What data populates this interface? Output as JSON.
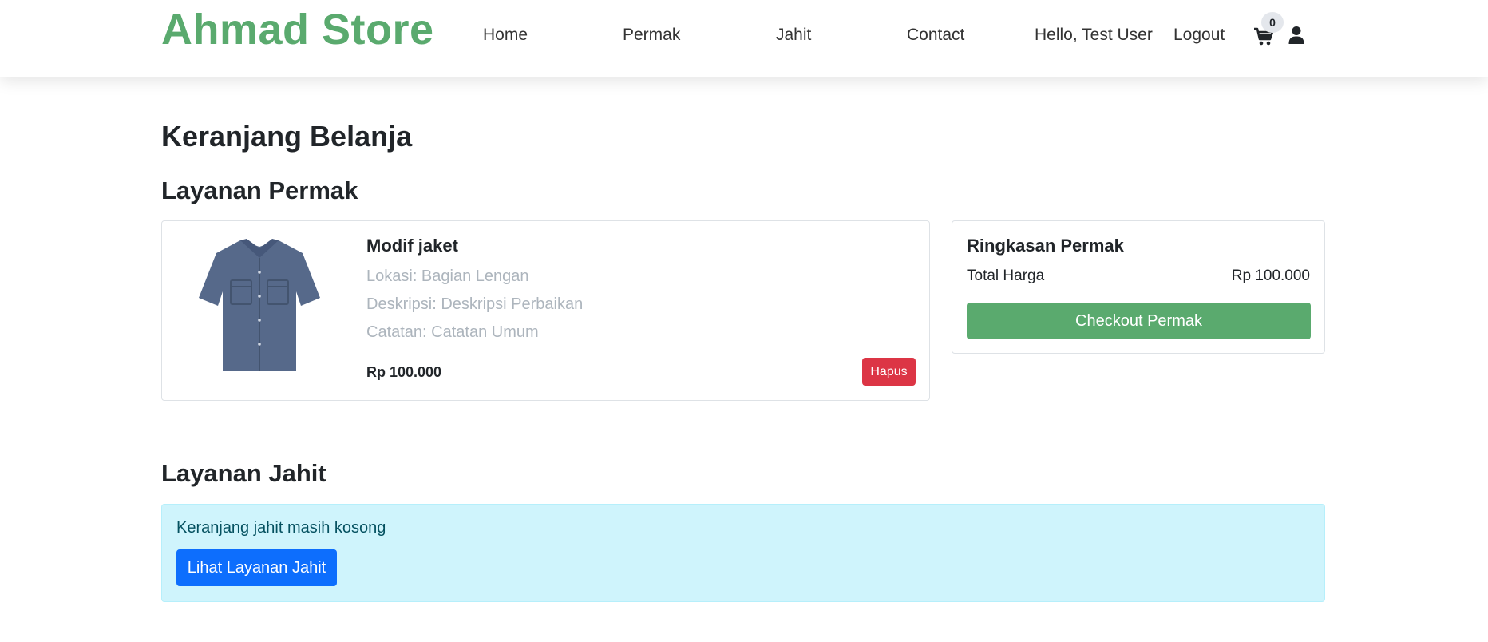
{
  "brand": {
    "name": "Ahmad Store",
    "color": "#5aaa6e"
  },
  "nav": {
    "links": [
      "Home",
      "Permak",
      "Jahit",
      "Contact"
    ],
    "greeting": "Hello, Test User",
    "logout": "Logout",
    "cart_count": "0",
    "icons": [
      "cart-icon",
      "user-icon"
    ]
  },
  "page": {
    "title": "Keranjang Belanja"
  },
  "permak": {
    "section_title": "Layanan Permak",
    "items": [
      {
        "image": "shirt-image",
        "title": "Modif jaket",
        "lokasi": "Lokasi: Bagian Lengan",
        "deskripsi": "Deskripsi: Deskripsi Perbaikan",
        "catatan": "Catatan: Catatan Umum",
        "price": "Rp 100.000",
        "delete_label": "Hapus"
      }
    ],
    "summary": {
      "title": "Ringkasan Permak",
      "total_label": "Total Harga",
      "total_value": "Rp 100.000",
      "checkout_label": "Checkout Permak"
    }
  },
  "jahit": {
    "section_title": "Layanan Jahit",
    "empty_message": "Keranjang jahit masih kosong",
    "cta_label": "Lihat Layanan Jahit"
  },
  "colors": {
    "primary_green": "#5aaa6e",
    "danger": "#dc3545",
    "primary_blue": "#0d6efd",
    "alert_bg": "#cff4fc"
  }
}
